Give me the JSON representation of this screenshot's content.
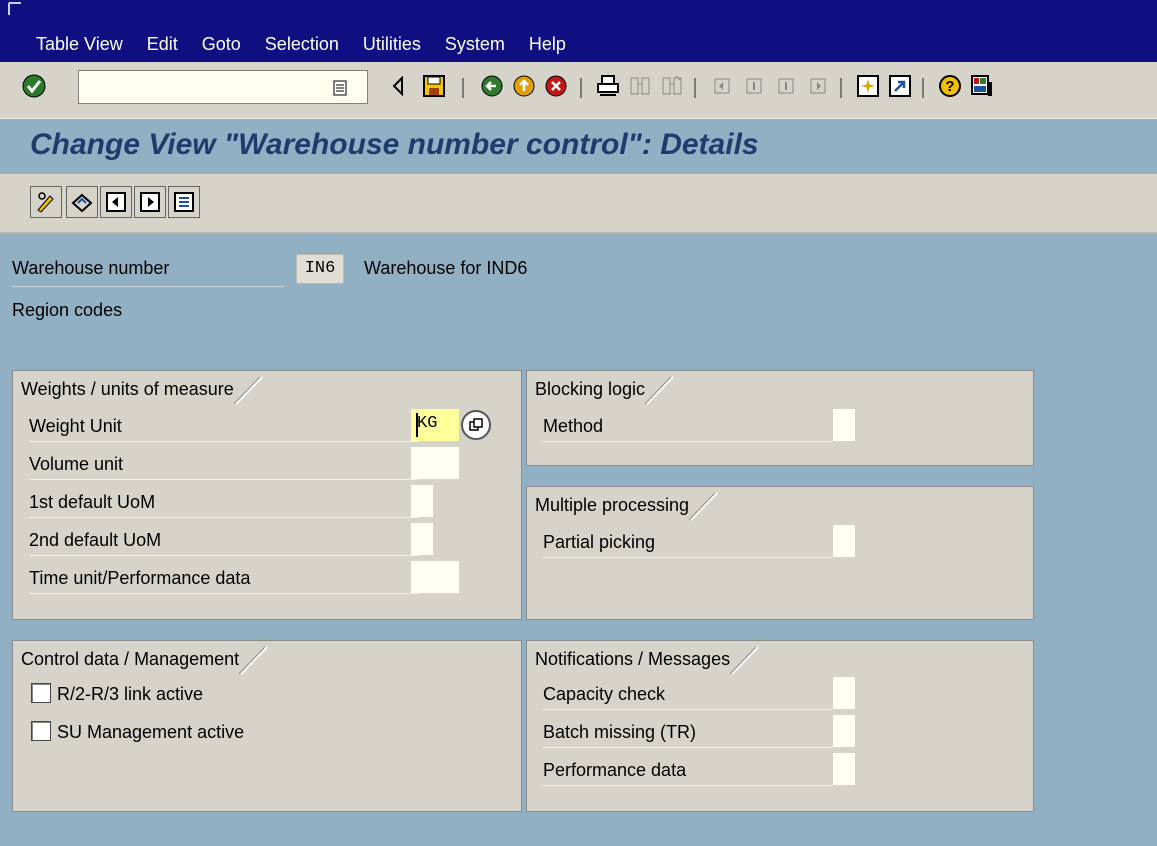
{
  "menu": [
    "Table View",
    "Edit",
    "Goto",
    "Selection",
    "Utilities",
    "System",
    "Help"
  ],
  "page_title": "Change View \"Warehouse number control\": Details",
  "header": {
    "warehouse_label": "Warehouse number",
    "warehouse_value": "IN6",
    "warehouse_desc": "Warehouse for IND6",
    "region_label": "Region codes"
  },
  "weights": {
    "title": "Weights / units of measure",
    "weight_unit_label": "Weight Unit",
    "weight_unit_value": "KG",
    "volume_unit_label": "Volume unit",
    "default_uom1_label": "1st default UoM",
    "default_uom2_label": "2nd default UoM",
    "time_unit_label": "Time unit/Performance data"
  },
  "blocking": {
    "title": "Blocking logic",
    "method_label": "Method"
  },
  "multiple": {
    "title": "Multiple processing",
    "partial_label": "Partial picking"
  },
  "control": {
    "title": "Control data / Management",
    "r2r3_label": "R/2-R/3 link active",
    "su_label": "SU Management active"
  },
  "notifications": {
    "title": "Notifications / Messages",
    "capacity_label": "Capacity check",
    "batch_label": "Batch missing (TR)",
    "performance_label": "Performance data"
  },
  "colors": {
    "menubar": "#0f0f82",
    "title": "#1e3d6d",
    "background": "#92b0c4",
    "panel": "#d6d3ca"
  }
}
